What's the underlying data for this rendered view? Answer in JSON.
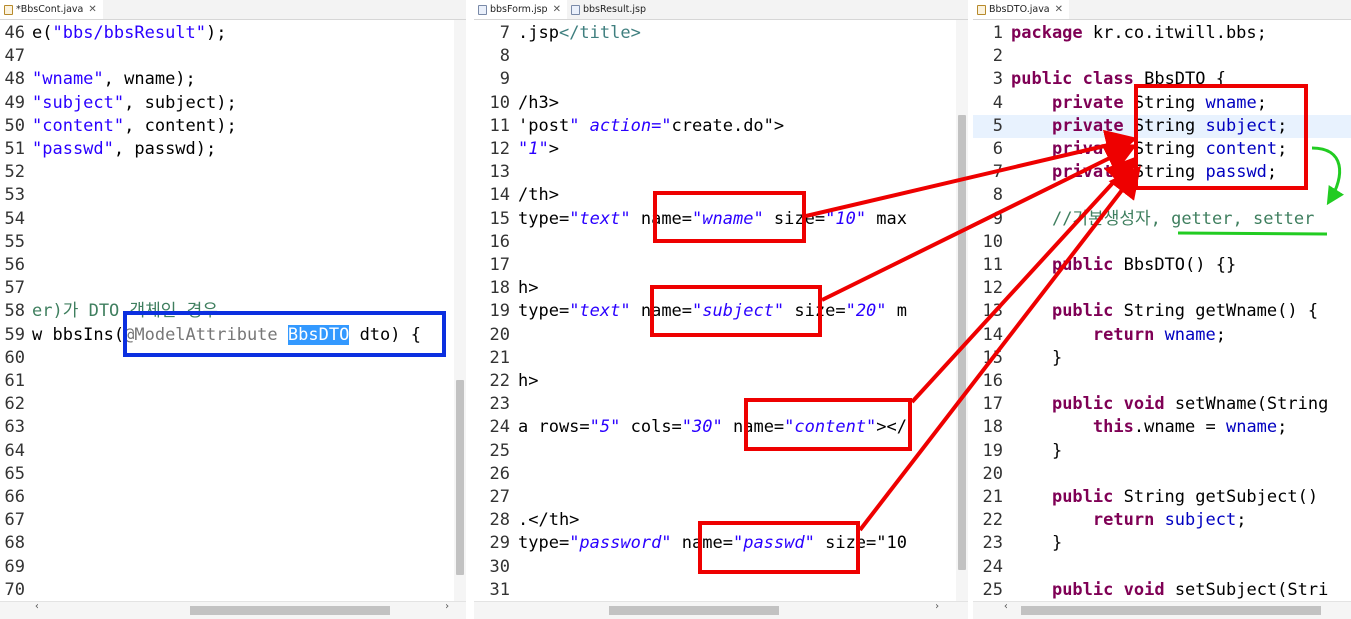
{
  "left_editor": {
    "tab": "*BbsCont.java",
    "lines": [
      {
        "n": "46",
        "code": "e(\"bbs/bbsResult\");"
      },
      {
        "n": "47",
        "code": ""
      },
      {
        "n": "48",
        "code": "\"wname\", wname);"
      },
      {
        "n": "49",
        "code": "\"subject\", subject);"
      },
      {
        "n": "50",
        "code": "\"content\", content);"
      },
      {
        "n": "51",
        "code": "\"passwd\", passwd);"
      },
      {
        "n": "52",
        "code": ""
      },
      {
        "n": "53",
        "code": ""
      },
      {
        "n": "54",
        "code": ""
      },
      {
        "n": "55",
        "code": ""
      },
      {
        "n": "56",
        "code": ""
      },
      {
        "n": "57",
        "code": ""
      },
      {
        "n": "58",
        "code": "er)가 DTO 객체인 경우"
      },
      {
        "n": "59",
        "code": "w bbsIns(@ModelAttribute BbsDTO dto) {"
      },
      {
        "n": "60",
        "code": ""
      },
      {
        "n": "61",
        "code": ""
      },
      {
        "n": "62",
        "code": ""
      },
      {
        "n": "63",
        "code": ""
      },
      {
        "n": "64",
        "code": ""
      },
      {
        "n": "65",
        "code": ""
      },
      {
        "n": "66",
        "code": ""
      },
      {
        "n": "67",
        "code": ""
      },
      {
        "n": "68",
        "code": ""
      },
      {
        "n": "69",
        "code": ""
      },
      {
        "n": "70",
        "code": ""
      }
    ]
  },
  "middle_editor": {
    "tabs": [
      "bbsForm.jsp",
      "bbsResult.jsp"
    ],
    "lines": [
      {
        "n": "7",
        "code": ".jsp</title>"
      },
      {
        "n": "8",
        "code": ""
      },
      {
        "n": "9",
        "code": ""
      },
      {
        "n": "10",
        "code": "/h3>"
      },
      {
        "n": "11",
        "code": "'post\" action=\"create.do\">"
      },
      {
        "n": "12",
        "code": "\"1\">"
      },
      {
        "n": "13",
        "code": ""
      },
      {
        "n": "14",
        "code": "/th>"
      },
      {
        "n": "15",
        "code": "type=\"text\" name=\"wname\" size=\"10\" max"
      },
      {
        "n": "16",
        "code": ""
      },
      {
        "n": "17",
        "code": ""
      },
      {
        "n": "18",
        "code": "h>"
      },
      {
        "n": "19",
        "code": "type=\"text\" name=\"subject\" size=\"20\" m"
      },
      {
        "n": "20",
        "code": ""
      },
      {
        "n": "21",
        "code": ""
      },
      {
        "n": "22",
        "code": "h>"
      },
      {
        "n": "23",
        "code": ""
      },
      {
        "n": "24",
        "code": "a rows=\"5\" cols=\"30\" name=\"content\"></"
      },
      {
        "n": "25",
        "code": ""
      },
      {
        "n": "26",
        "code": ""
      },
      {
        "n": "27",
        "code": ""
      },
      {
        "n": "28",
        "code": ".</th>"
      },
      {
        "n": "29",
        "code": "type=\"password\" name=\"passwd\" size=\"10"
      },
      {
        "n": "30",
        "code": ""
      },
      {
        "n": "31",
        "code": ""
      }
    ]
  },
  "right_editor": {
    "tab": "BbsDTO.java",
    "lines": [
      {
        "n": "1",
        "code": "package kr.co.itwill.bbs;"
      },
      {
        "n": "2",
        "code": ""
      },
      {
        "n": "3",
        "code": "public class BbsDTO {"
      },
      {
        "n": "4",
        "code": "    private String wname;"
      },
      {
        "n": "5",
        "code": "    private String subject;"
      },
      {
        "n": "6",
        "code": "    private String content;"
      },
      {
        "n": "7",
        "code": "    private String passwd;"
      },
      {
        "n": "8",
        "code": ""
      },
      {
        "n": "9",
        "code": "    //기본생성자, getter, setter"
      },
      {
        "n": "10",
        "code": ""
      },
      {
        "n": "11",
        "code": "    public BbsDTO() {}"
      },
      {
        "n": "12",
        "code": ""
      },
      {
        "n": "13",
        "code": "    public String getWname() {"
      },
      {
        "n": "14",
        "code": "        return wname;"
      },
      {
        "n": "15",
        "code": "    }"
      },
      {
        "n": "16",
        "code": ""
      },
      {
        "n": "17",
        "code": "    public void setWname(String"
      },
      {
        "n": "18",
        "code": "        this.wname = wname;"
      },
      {
        "n": "19",
        "code": "    }"
      },
      {
        "n": "20",
        "code": ""
      },
      {
        "n": "21",
        "code": "    public String getSubject()"
      },
      {
        "n": "22",
        "code": "        return subject;"
      },
      {
        "n": "23",
        "code": "    }"
      },
      {
        "n": "24",
        "code": ""
      },
      {
        "n": "25",
        "code": "    public void setSubject(Stri"
      }
    ]
  },
  "annotations": {
    "red_color": "#ee0000",
    "blue_color": "#0b2fe0",
    "green_color": "#22cc22"
  }
}
